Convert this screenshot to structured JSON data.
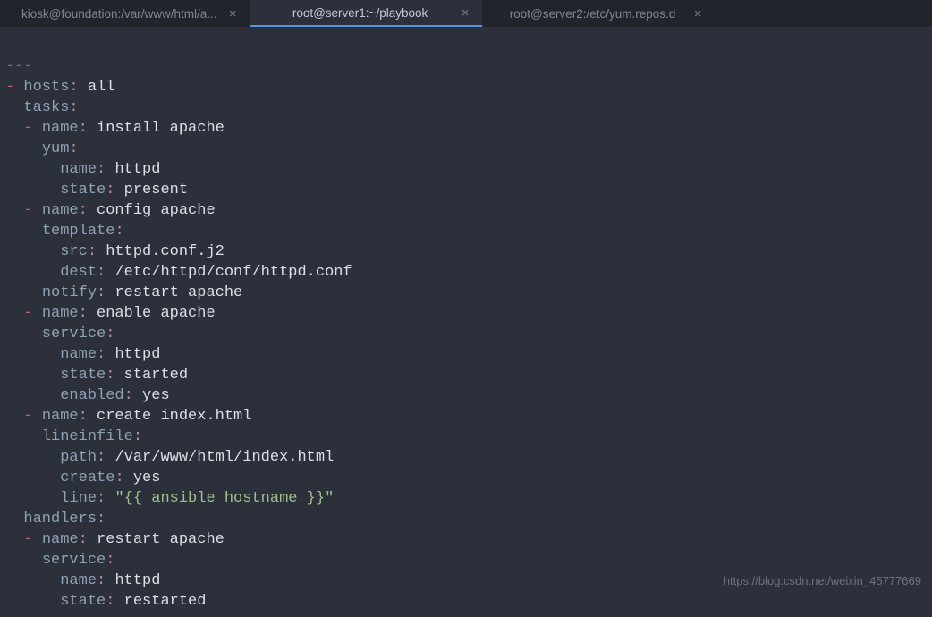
{
  "tabs": [
    {
      "label": "kiosk@foundation:/var/www/html/a...",
      "active": false
    },
    {
      "label": "root@server1:~/playbook",
      "active": true
    },
    {
      "label": "root@server2:/etc/yum.repos.d",
      "active": false
    }
  ],
  "close_glyph": "×",
  "watermark": "https://blog.csdn.net/weixin_45777669",
  "code": {
    "doc_start": "---",
    "hosts_key": "hosts",
    "hosts_val": "all",
    "tasks_key": "tasks",
    "t1_name_key": "name",
    "t1_name_val": "install apache",
    "t1_mod": "yum",
    "t1_a1k": "name",
    "t1_a1v": "httpd",
    "t1_a2k": "state",
    "t1_a2v": "present",
    "t2_name_key": "name",
    "t2_name_val": "config apache",
    "t2_mod": "template",
    "t2_a1k": "src",
    "t2_a1v": "httpd.conf.j2",
    "t2_a2k": "dest",
    "t2_a2v": "/etc/httpd/conf/httpd.conf",
    "t2_notify_key": "notify",
    "t2_notify_val": "restart apache",
    "t3_name_key": "name",
    "t3_name_val": "enable apache",
    "t3_mod": "service",
    "t3_a1k": "name",
    "t3_a1v": "httpd",
    "t3_a2k": "state",
    "t3_a2v": "started",
    "t3_a3k": "enabled",
    "t3_a3v": "yes",
    "t4_name_key": "name",
    "t4_name_val": "create index.html",
    "t4_mod": "lineinfile",
    "t4_a1k": "path",
    "t4_a1v": "/var/www/html/index.html",
    "t4_a2k": "create",
    "t4_a2v": "yes",
    "t4_a3k": "line",
    "t4_a3v": "\"{{ ansible_hostname }}\"",
    "handlers_key": "handlers",
    "h1_name_key": "name",
    "h1_name_val": "restart apache",
    "h1_mod": "service",
    "h1_a1k": "name",
    "h1_a1v": "httpd",
    "h1_a2k": "state",
    "h1_a2v": "restarted"
  }
}
